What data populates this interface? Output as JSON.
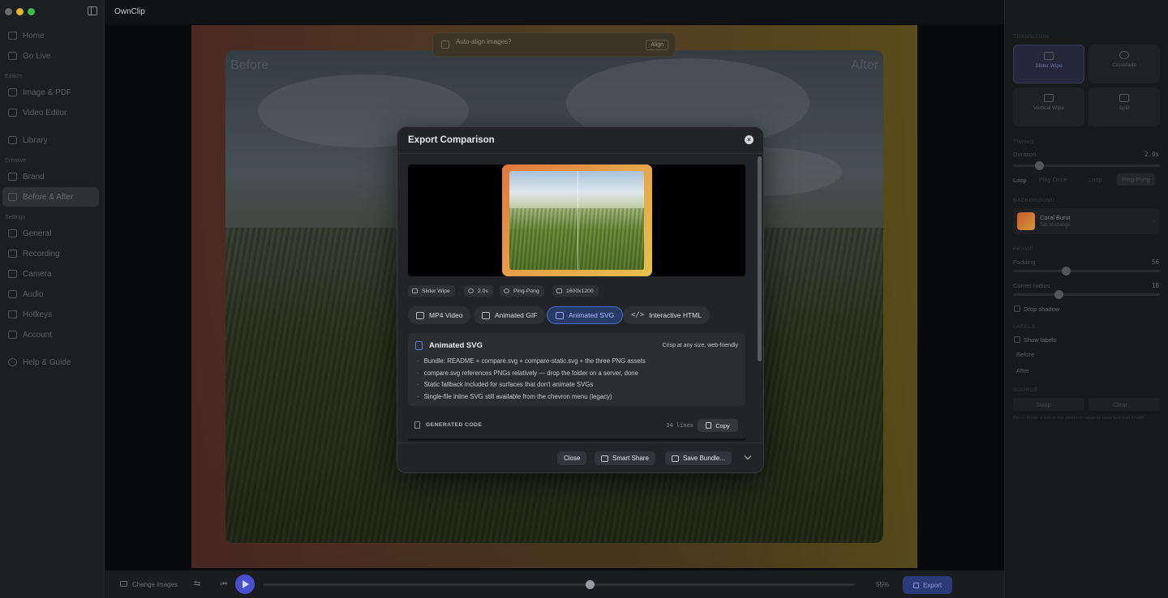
{
  "app": {
    "title": "OwnClip"
  },
  "sidebar": {
    "items": [
      {
        "label": "Home",
        "icon": "home-icon"
      },
      {
        "label": "Go Live",
        "icon": "broadcast-icon"
      },
      {
        "label": "Image & PDF",
        "icon": "image-icon"
      },
      {
        "label": "Video Editor",
        "icon": "video-icon"
      },
      {
        "label": "Library",
        "icon": "folder-icon"
      },
      {
        "label": "Brand",
        "icon": "brush-icon"
      },
      {
        "label": "Before & After",
        "icon": "compare-icon"
      },
      {
        "label": "General",
        "icon": "gear-icon"
      },
      {
        "label": "Recording",
        "icon": "recording-icon"
      },
      {
        "label": "Camera",
        "icon": "camera-icon"
      },
      {
        "label": "Audio",
        "icon": "audio-icon"
      },
      {
        "label": "Hotkeys",
        "icon": "keyboard-icon"
      },
      {
        "label": "Account",
        "icon": "account-icon"
      },
      {
        "label": "Help & Guide",
        "icon": "help-icon"
      }
    ],
    "sections": [
      "Editors",
      "Creative",
      "Settings"
    ]
  },
  "canvas": {
    "before_label": "Before",
    "after_label": "After",
    "align_prompt": "Auto-align images?",
    "align_button": "Align"
  },
  "bottombar": {
    "change_images": "Change images",
    "zoom": "55%",
    "export": "Export",
    "progress": 0.55
  },
  "rpanel": {
    "transition_head": "TRANSITION",
    "transitions": [
      "Slider Wipe",
      "Crossfade",
      "Vertical Wipe",
      "Split"
    ],
    "timing_head": "TIMING",
    "duration_label": "Duration",
    "duration_value": "2.0s",
    "loop_label": "Loop",
    "loop_options": [
      "Play Once",
      "Loop",
      "Ping-Pong"
    ],
    "background_head": "BACKGROUND",
    "bg_name": "Coral Burst",
    "bg_sub": "Tap to change",
    "frame_head": "FRAME",
    "padding_label": "Padding",
    "padding_value": "56",
    "radius_label": "Corner radius",
    "radius_value": "18",
    "drop_shadow": "Drop shadow",
    "labels_head": "LABELS",
    "show_labels": "Show labels",
    "before": "Before",
    "after": "After",
    "source_head": "SOURCE",
    "swap": "Swap",
    "clear": "Clear",
    "tip": "Tip — hover a slot in the picker to swap or clear just that image."
  },
  "modal": {
    "title": "Export Comparison",
    "pills": [
      "Slider Wipe",
      "2.0s",
      "Ping-Pong",
      "1600x1200"
    ],
    "formats": [
      "MP4 Video",
      "Animated GIF",
      "Animated SVG",
      "Interactive HTML"
    ],
    "selected_format": "Animated SVG",
    "desc_title": "Animated SVG",
    "desc_sub": "Crisp at any size, web-friendly",
    "bullets": [
      "Bundle: README + compare.svg + compare-static.svg + the three PNG assets",
      "compare.svg references PNGs relatively — drop the folder on a server, done",
      "Static fallback included for surfaces that don't animate SVGs",
      "Single-file inline SVG still available from the chevron menu (legacy)"
    ],
    "generated_code": "GENERATED CODE",
    "lines": "34 lines",
    "copy": "Copy",
    "close": "Close",
    "smart_share": "Smart Share",
    "save_bundle": "Save Bundle..."
  },
  "colors": {
    "accent": "#4a6ad8",
    "play": "#4a4fd0",
    "traffic_red": "#5a5b5f"
  }
}
